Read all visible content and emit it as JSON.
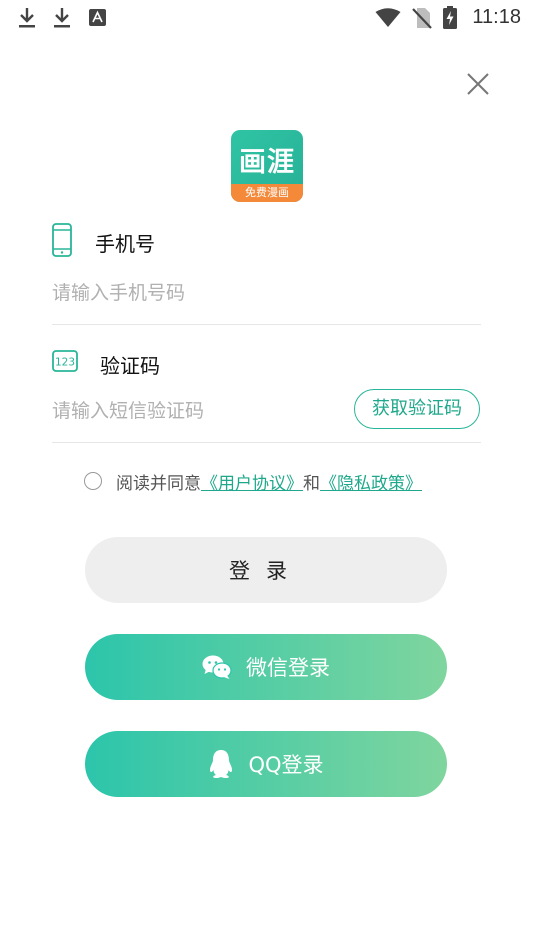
{
  "status_bar": {
    "time": "11:18",
    "icons": [
      "download-icon",
      "download-icon",
      "font-icon",
      "wifi-icon",
      "no-sim-icon",
      "battery-charging-icon"
    ]
  },
  "logo": {
    "title": "画涯",
    "subtitle": "免费漫画"
  },
  "phone": {
    "label": "手机号",
    "placeholder": "请输入手机号码",
    "value": ""
  },
  "code": {
    "label": "验证码",
    "placeholder": "请输入短信验证码",
    "value": "",
    "get_code_label": "获取验证码"
  },
  "agreement": {
    "prefix": "阅读并同意",
    "user_agreement": "《用户协议》",
    "and": "和",
    "privacy_policy": "《隐私政策》",
    "checked": false
  },
  "buttons": {
    "login": "登录",
    "wechat": "微信登录",
    "qq": "QQ登录"
  },
  "colors": {
    "accent": "#28b698",
    "gradient_start": "#2cc5ab",
    "gradient_end": "#7fd59e",
    "login_bg": "#eeeeee"
  }
}
